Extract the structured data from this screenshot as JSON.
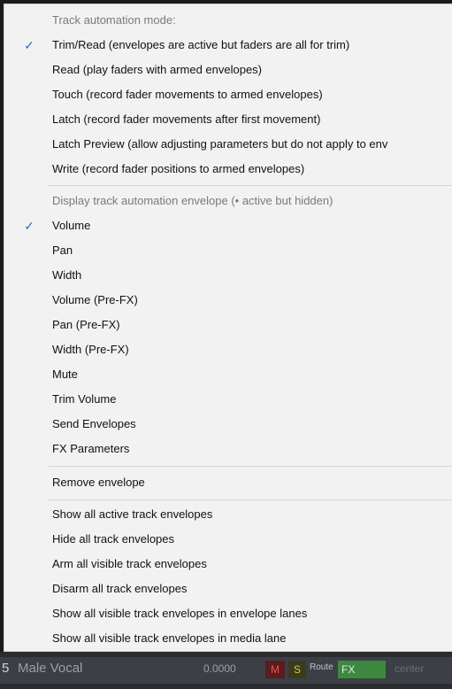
{
  "menu": {
    "automation_header": "Track automation mode:",
    "modes": [
      {
        "label": "Trim/Read (envelopes are active but faders are all for trim)",
        "checked": true
      },
      {
        "label": "Read (play faders with armed envelopes)",
        "checked": false
      },
      {
        "label": "Touch (record fader movements to armed envelopes)",
        "checked": false
      },
      {
        "label": "Latch (record fader movements after first movement)",
        "checked": false
      },
      {
        "label": "Latch Preview (allow adjusting parameters but do not apply to env",
        "checked": false
      },
      {
        "label": "Write (record fader positions to armed envelopes)",
        "checked": false
      }
    ],
    "display_header": "Display track automation envelope (• active but hidden)",
    "envelopes": [
      {
        "label": "Volume",
        "checked": true
      },
      {
        "label": "Pan",
        "checked": false
      },
      {
        "label": "Width",
        "checked": false
      },
      {
        "label": "Volume (Pre-FX)",
        "checked": false
      },
      {
        "label": "Pan (Pre-FX)",
        "checked": false
      },
      {
        "label": "Width (Pre-FX)",
        "checked": false
      },
      {
        "label": "Mute",
        "checked": false
      },
      {
        "label": "Trim Volume",
        "checked": false
      },
      {
        "label": "Send Envelopes",
        "checked": false
      },
      {
        "label": "FX Parameters",
        "checked": false
      }
    ],
    "remove_envelope": "Remove envelope",
    "actions": [
      "Show all active track envelopes",
      "Hide all track envelopes",
      "Arm all visible track envelopes",
      "Disarm all track envelopes",
      "Show all visible track envelopes in envelope lanes",
      "Show all visible track envelopes in media lane"
    ],
    "check_glyph": "✓"
  },
  "track": {
    "number": "5",
    "name": "Male Vocal",
    "volume": "0.0000",
    "mute": "M",
    "solo": "S",
    "route": "Route",
    "fx": "FX",
    "pan": "center"
  },
  "colors": {
    "menu_bg": "#f2f2f2",
    "check": "#2f6fd0",
    "header_text": "#7a7a7a",
    "fx_green": "#3c8a40"
  }
}
